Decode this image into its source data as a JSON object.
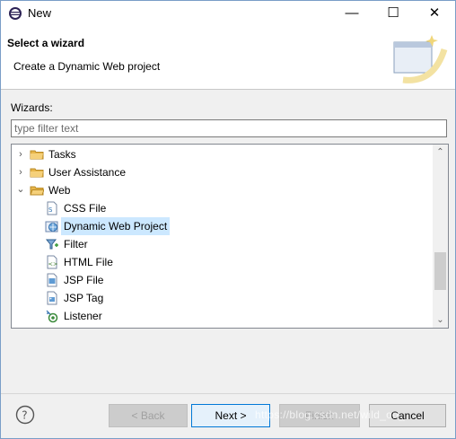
{
  "window": {
    "title": "New",
    "icons": {
      "app": "eclipse-icon",
      "minimize": "minimize-icon",
      "maximize": "maximize-icon",
      "close": "close-icon"
    },
    "minimize_glyph": "—",
    "maximize_glyph": "☐",
    "close_glyph": "✕"
  },
  "header": {
    "title": "Select a wizard",
    "description": "Create a Dynamic Web project",
    "banner_icon": "new-wizard-banner-icon"
  },
  "wizards": {
    "label": "Wizards:",
    "filter_placeholder": "type filter text",
    "filter_value": ""
  },
  "tree": {
    "items": [
      {
        "label": "Tasks",
        "expanded": false,
        "icon": "folder-icon",
        "level": 0
      },
      {
        "label": "User Assistance",
        "expanded": false,
        "icon": "folder-icon",
        "level": 0
      },
      {
        "label": "Web",
        "expanded": true,
        "icon": "folder-icon",
        "level": 0
      },
      {
        "label": "CSS File",
        "icon": "css-file-icon",
        "level": 1
      },
      {
        "label": "Dynamic Web Project",
        "icon": "dynamic-web-project-icon",
        "level": 1,
        "selected": true
      },
      {
        "label": "Filter",
        "icon": "filter-icon",
        "level": 1
      },
      {
        "label": "HTML File",
        "icon": "html-file-icon",
        "level": 1
      },
      {
        "label": "JSP File",
        "icon": "jsp-file-icon",
        "level": 1
      },
      {
        "label": "JSP Tag",
        "icon": "jsp-tag-icon",
        "level": 1
      },
      {
        "label": "Listener",
        "icon": "listener-icon",
        "level": 1
      }
    ],
    "scroll_up_glyph": "⌃",
    "scroll_down_glyph": "⌄"
  },
  "buttons": {
    "help_icon": "help-icon",
    "back": "< Back",
    "next": "Next >",
    "finish": "Finish",
    "cancel": "Cancel"
  },
  "watermark": "https://blog.csdn.net/wild_on_",
  "colors": {
    "accent": "#0078d7",
    "selection": "#cce8ff",
    "folder": "#e8b64a"
  }
}
